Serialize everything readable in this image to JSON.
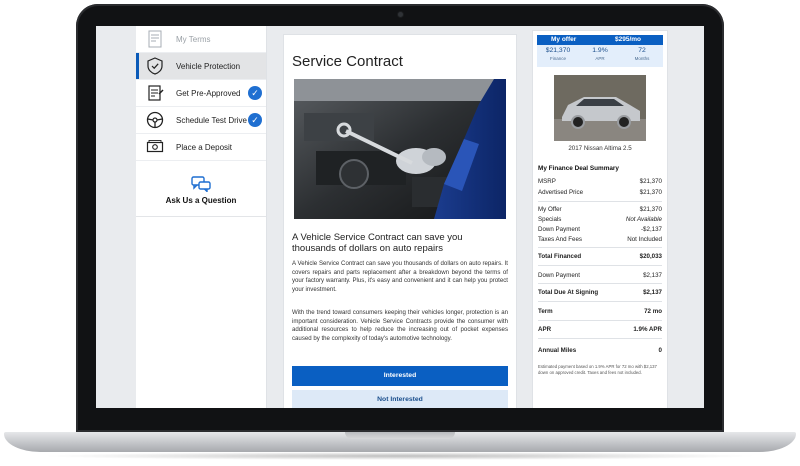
{
  "sidebar": {
    "items": [
      {
        "label": "My Terms"
      },
      {
        "label": "Vehicle Protection"
      },
      {
        "label": "Get Pre-Approved"
      },
      {
        "label": "Schedule Test Drive"
      },
      {
        "label": "Place a Deposit"
      }
    ],
    "ask_label": "Ask Us a Question"
  },
  "main": {
    "title": "Service Contract",
    "subtitle": "A Vehicle Service Contract can save you thousands of dollars on auto repairs",
    "paragraph1": "A Vehicle Service Contract can save you thousands of dollars on auto repairs. It covers repairs and parts replacement after a breakdown beyond the terms of your factory warranty. Plus, it's easy and convenient and it can help you protect your investment.",
    "paragraph2": "With the trend toward consumers keeping their vehicles longer, protection is an important consideration. Vehicle Service Contracts provide the consumer with additional resources to help reduce the increasing out of pocket expenses caused by the complexity of today's automotive technology.",
    "interested_label": "Interested",
    "not_interested_label": "Not Interested"
  },
  "offer": {
    "label": "My offer",
    "monthly": "$295/mo",
    "cells": [
      {
        "value": "$21,370",
        "label": "Finance"
      },
      {
        "value": "1.9%",
        "label": "APR"
      },
      {
        "value": "72",
        "label": "Months"
      }
    ]
  },
  "vehicle": {
    "name": "2017 Nissan Altima 2.5"
  },
  "summary": {
    "title": "My Finance Deal Summary",
    "msrp": {
      "label": "MSRP",
      "value": "$21,370"
    },
    "advertised": {
      "label": "Advertised Price",
      "value": "$21,370"
    },
    "my_offer": {
      "label": "My Offer",
      "value": "$21,370"
    },
    "specials": {
      "label": "Specials",
      "value": "Not Available"
    },
    "down_payment": {
      "label": "Down Payment",
      "value": "-$2,137"
    },
    "taxes": {
      "label": "Taxes And Fees",
      "value": "Not Included"
    },
    "total_financed": {
      "label": "Total Financed",
      "value": "$20,033"
    },
    "down_payment2": {
      "label": "Down Payment",
      "value": "$2,137"
    },
    "total_due": {
      "label": "Total Due At Signing",
      "value": "$2,137"
    },
    "term": {
      "label": "Term",
      "value": "72 mo"
    },
    "apr": {
      "label": "APR",
      "value": "1.9% APR"
    },
    "annual_miles": {
      "label": "Annual Miles",
      "value": "0"
    },
    "disclaimer": "Estimated payment based on 1.9% APR for 72 mo with $2,137 down on approved credit. Taxes and fees not included."
  },
  "colors": {
    "accent": "#0a5fc2",
    "accent_light": "#dde9f7",
    "check": "#1f6fd1"
  }
}
